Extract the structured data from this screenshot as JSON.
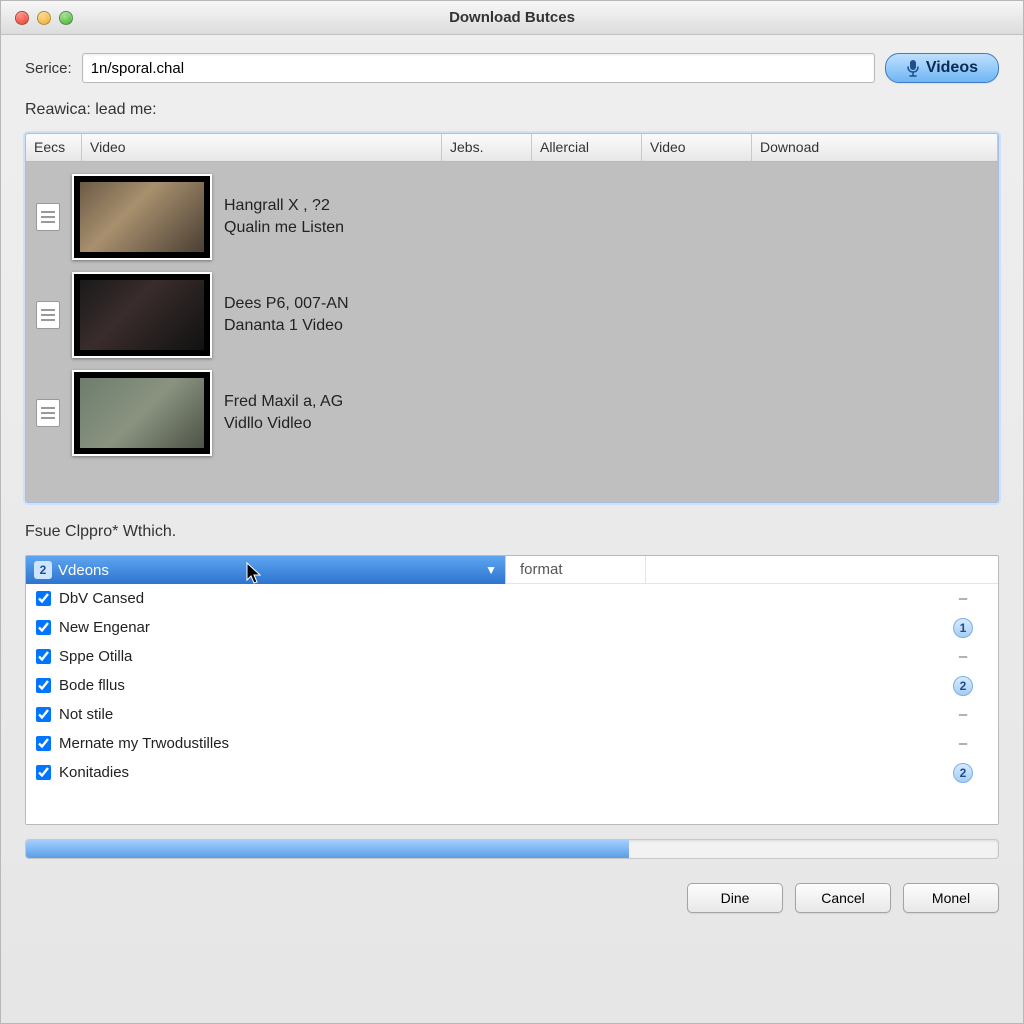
{
  "window": {
    "title": "Download Butces"
  },
  "source": {
    "label": "Serice:",
    "value": "1n/sporal.chal",
    "videos_button": "Videos"
  },
  "results": {
    "label": "Reawica: lead me:",
    "columns": [
      "Eecs",
      "Video",
      "Jebs.",
      "Allercial",
      "Video",
      "Downoad"
    ],
    "items": [
      {
        "line1": "Hangrall X , ?2",
        "line2": "Qualin me Listen"
      },
      {
        "line1": "Dees P6, 007-AN",
        "line2": "Dananta 1 Video"
      },
      {
        "line1": "Fred Maxil a, AG",
        "line2": "Vidllo Vidleo"
      }
    ]
  },
  "options": {
    "label": "Fsue Clppro* Wthich.",
    "dropdown_badge": "2",
    "dropdown_label": "Vdeons",
    "format_header": "format",
    "rows": [
      {
        "label": "DbV Cansed",
        "value": "–",
        "pill": false
      },
      {
        "label": "New Engenar",
        "value": "1",
        "pill": true
      },
      {
        "label": "Sppe Otilla",
        "value": "–",
        "pill": false
      },
      {
        "label": "Bode fllus",
        "value": "2",
        "pill": true
      },
      {
        "label": "Not stile",
        "value": "–",
        "pill": false
      },
      {
        "label": "Mernate my Trwodustilles",
        "value": "–",
        "pill": false
      },
      {
        "label": "Konitadies",
        "value": "2",
        "pill": true
      }
    ]
  },
  "progress": {
    "percent": 62
  },
  "footer": {
    "dine": "Dine",
    "cancel": "Cancel",
    "monel": "Monel"
  }
}
